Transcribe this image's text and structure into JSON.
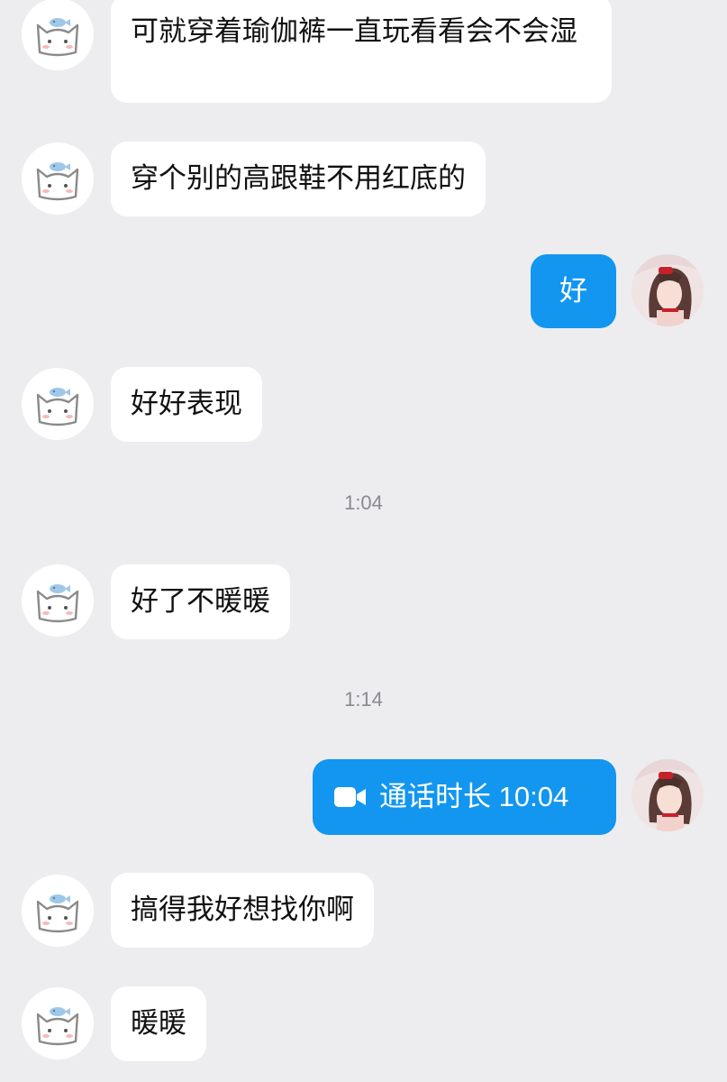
{
  "chat": {
    "messages": [
      {
        "side": "in",
        "text": "可就穿着瑜伽裤一直玩看看会不会湿"
      },
      {
        "side": "in",
        "text": "穿个别的高跟鞋不用红底的"
      },
      {
        "side": "out",
        "text": "好"
      },
      {
        "side": "in",
        "text": "好好表现"
      },
      {
        "time": "1:04"
      },
      {
        "side": "in",
        "text": "好了不暖暖"
      },
      {
        "time": "1:14"
      },
      {
        "side": "out",
        "type": "video-call",
        "icon": "video-camera-icon",
        "text": "通话时长 10:04"
      },
      {
        "side": "in",
        "text": "搞得我好想找你啊"
      },
      {
        "side": "in",
        "text": "暖暖"
      }
    ]
  },
  "colors": {
    "background": "#ededf0",
    "incoming_bubble": "#ffffff",
    "outgoing_bubble": "#1296f0",
    "timestamp": "#8a8a8e"
  }
}
